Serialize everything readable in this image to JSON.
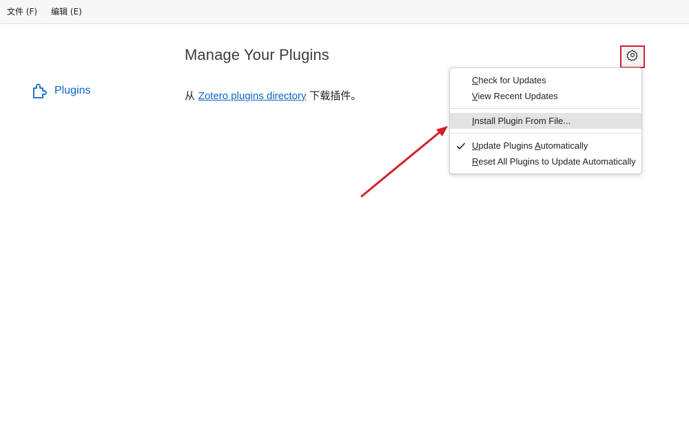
{
  "menubar": {
    "file": "文件 (F)",
    "edit": "编辑 (E)"
  },
  "sidebar": {
    "items": [
      {
        "label": "Plugins",
        "icon": "puzzle-icon"
      }
    ]
  },
  "main": {
    "title": "Manage Your Plugins",
    "subtitle_prefix": "从 ",
    "link_text": "Zotero plugins directory",
    "subtitle_suffix": " 下载插件。"
  },
  "toolbar": {
    "gear_icon": "gear-icon"
  },
  "dropdown": {
    "items": [
      {
        "key": "C",
        "rest": "heck for Updates"
      },
      {
        "key": "V",
        "rest": "iew Recent Updates"
      },
      {
        "key": "I",
        "rest": "nstall Plugin From File..."
      },
      {
        "pre": "",
        "key": "U",
        "rest": "pdate Plugins ",
        "key2": "A",
        "rest2": "utomatically",
        "checked": true
      },
      {
        "key": "R",
        "rest": "eset All Plugins to Update Automatically"
      }
    ]
  },
  "colors": {
    "accent": "#0b63c9",
    "annotation": "#d21f26",
    "highlight": "#e3e3e3"
  }
}
